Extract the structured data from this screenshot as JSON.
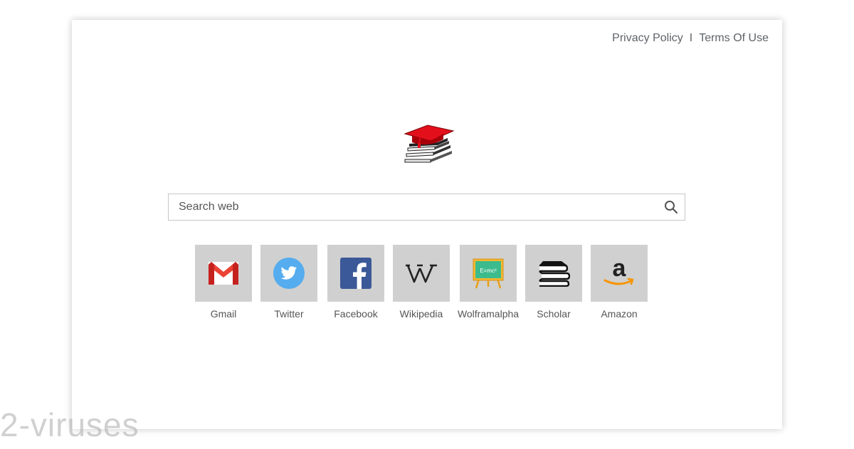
{
  "header": {
    "privacy_label": "Privacy Policy",
    "separator": "I",
    "terms_label": "Terms Of Use"
  },
  "logo": {
    "icon": "graduation-cap-books-icon"
  },
  "search": {
    "placeholder": "Search web",
    "value": "",
    "icon": "search-icon"
  },
  "shortcuts": [
    {
      "label": "Gmail",
      "icon": "gmail-icon"
    },
    {
      "label": "Twitter",
      "icon": "twitter-icon"
    },
    {
      "label": "Facebook",
      "icon": "facebook-icon"
    },
    {
      "label": "Wikipedia",
      "icon": "wikipedia-icon"
    },
    {
      "label": "Wolframalpha",
      "icon": "chalkboard-icon"
    },
    {
      "label": "Scholar",
      "icon": "books-icon"
    },
    {
      "label": "Amazon",
      "icon": "amazon-icon"
    }
  ],
  "watermark": "2-viruses",
  "colors": {
    "tile_bg": "#d0d0d0",
    "link_text": "#5f6368",
    "gmail_red": "#ea4335",
    "twitter_blue": "#55acee",
    "facebook_blue": "#3b5998",
    "amazon_orange": "#f79400",
    "cap_red": "#e3101b"
  }
}
